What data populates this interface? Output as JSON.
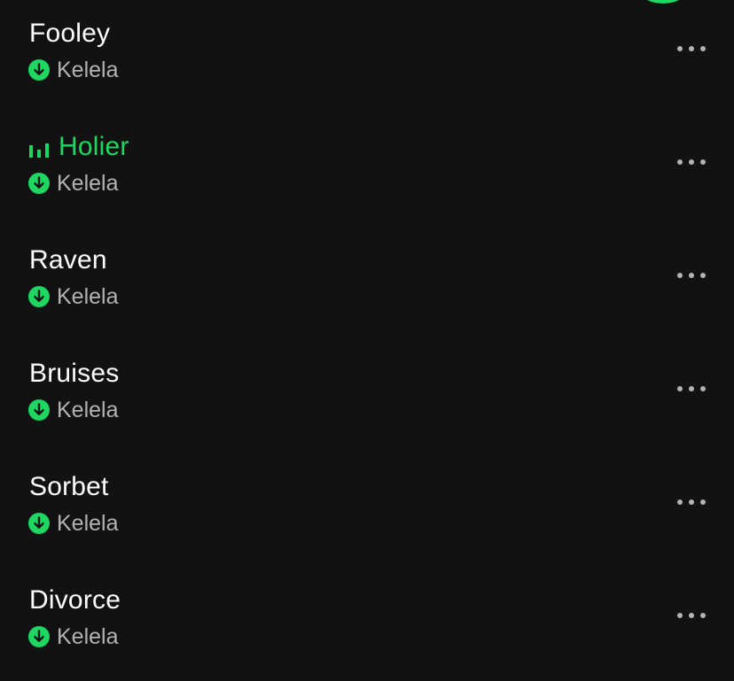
{
  "colors": {
    "background": "#121212",
    "title": "#ffffff",
    "subtitle": "#b3b3b3",
    "accent": "#1ed760",
    "more_dots": "#b3b3b3"
  },
  "icons": {
    "downloaded": "arrow-down-circle-icon",
    "now_playing": "equalizer-bars-icon",
    "more": "more-horizontal-icon"
  },
  "tracks": [
    {
      "title": "Fooley",
      "artist": "Kelela",
      "downloaded": true,
      "playing": false
    },
    {
      "title": "Holier",
      "artist": "Kelela",
      "downloaded": true,
      "playing": true
    },
    {
      "title": "Raven",
      "artist": "Kelela",
      "downloaded": true,
      "playing": false
    },
    {
      "title": "Bruises",
      "artist": "Kelela",
      "downloaded": true,
      "playing": false
    },
    {
      "title": "Sorbet",
      "artist": "Kelela",
      "downloaded": true,
      "playing": false
    },
    {
      "title": "Divorce",
      "artist": "Kelela",
      "downloaded": true,
      "playing": false
    }
  ]
}
